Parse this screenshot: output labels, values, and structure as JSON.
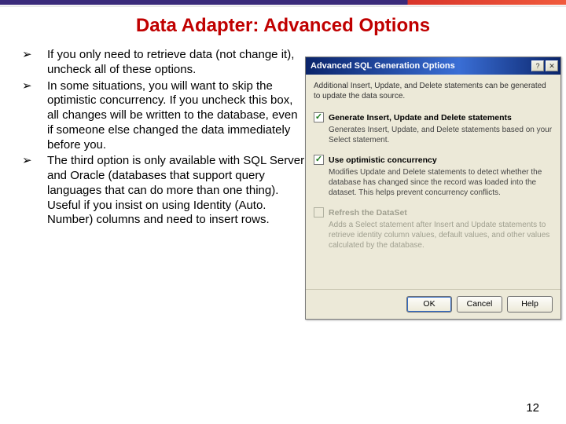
{
  "title": "Data Adapter: Advanced Options",
  "bullets": [
    "If you only need to retrieve data (not change it), uncheck all of these options.",
    "In some situations, you will want to skip the optimistic concurrency. If you uncheck this box, all changes will be written to the database, even if someone else changed the data immediately before you.",
    "The third option is only available with SQL Server and Oracle (databases that support query languages that can do more than one thing). Useful if you insist on using Identity (Auto. Number) columns and need to insert rows."
  ],
  "page_number": "12",
  "dialog": {
    "title": "Advanced SQL Generation Options",
    "intro": "Additional Insert, Update, and Delete statements can be generated to update the data source.",
    "opt1": {
      "label": "Generate Insert, Update and Delete statements",
      "desc": "Generates Insert, Update, and Delete statements based on your Select statement."
    },
    "opt2": {
      "label": "Use optimistic concurrency",
      "desc": "Modifies Update and Delete statements to detect whether the database has changed since the record was loaded into the dataset. This helps prevent concurrency conflicts."
    },
    "opt3": {
      "label": "Refresh the DataSet",
      "desc": "Adds a Select statement after Insert and Update statements to retrieve identity column values, default values, and other values calculated by the database."
    },
    "buttons": {
      "ok": "OK",
      "cancel": "Cancel",
      "help": "Help"
    },
    "tb": {
      "help": "?",
      "close": "✕"
    }
  }
}
